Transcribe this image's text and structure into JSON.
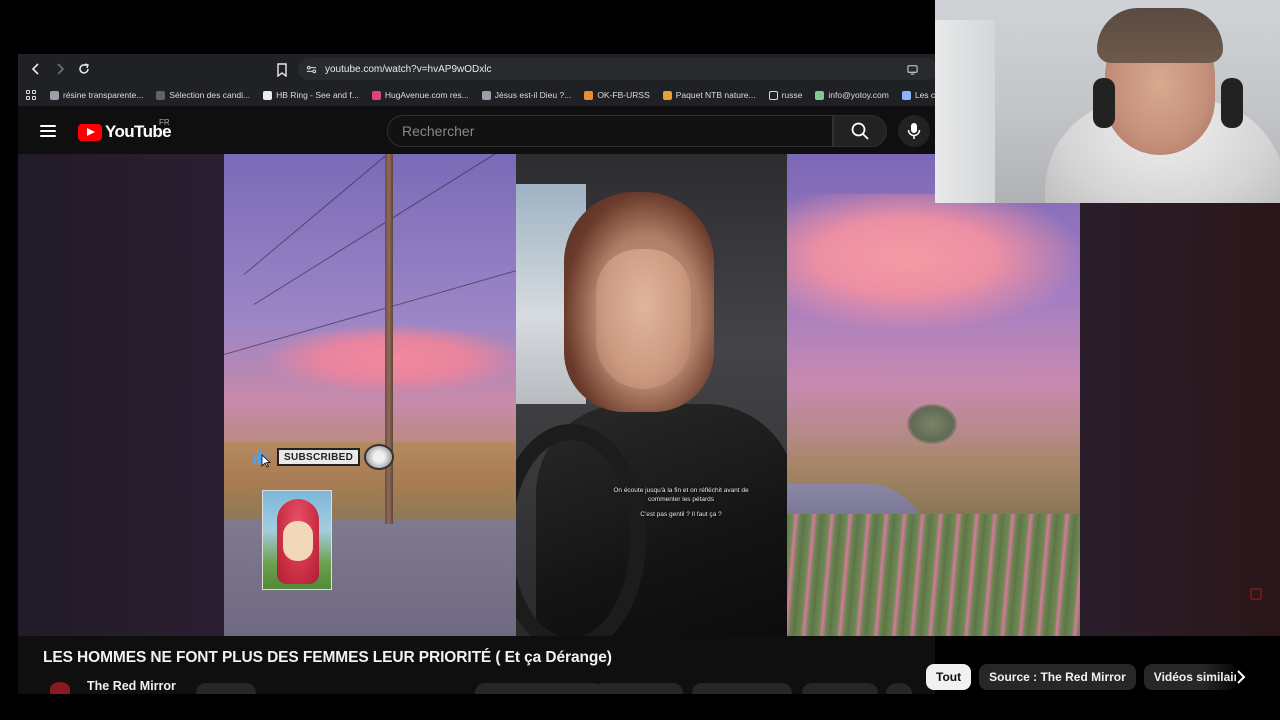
{
  "browser": {
    "url": "youtube.com/watch?v=hvAP9wODxlc",
    "bookmarks": [
      {
        "label": "résine transparente...",
        "color": "#9aa0a6"
      },
      {
        "label": "Sélection des candi...",
        "color": "#5f6368"
      },
      {
        "label": "HB Ring - See and f...",
        "color": "#e8eaed"
      },
      {
        "label": "HugAvenue.com res...",
        "color": "#e0427a"
      },
      {
        "label": "Jésus est-il Dieu ?...",
        "color": "#9aa0a6"
      },
      {
        "label": "OK-FB-URSS",
        "color": "#f28b30"
      },
      {
        "label": "Paquet NTB nature...",
        "color": "#e8a030"
      },
      {
        "label": "russe",
        "color": "#dadce0"
      },
      {
        "label": "info@yotoy.com",
        "color": "#81c995"
      },
      {
        "label": "Les concours",
        "color": "#8ab4f8"
      }
    ]
  },
  "youtube": {
    "logo_text": "YouTube",
    "region": "FR",
    "search_placeholder": "Rechercher",
    "brand_color": "#ff0000"
  },
  "video": {
    "caption_line1": "On écoute jusqu'à la fin et on réfléchit avant de commenter les pétards",
    "caption_line2": "C'est pas gentil ? Il faut ça ?",
    "subscribe_badge": "SUBSCRIBED",
    "title": "LES HOMMES NE FONT PLUS DES FEMMES LEUR PRIORITÉ ( Et ça Dérange)",
    "channel": "The Red Mirror"
  },
  "chips": [
    {
      "label": "Tout",
      "active": true
    },
    {
      "label": "Source : The Red Mirror",
      "active": false
    },
    {
      "label": "Vidéos similaires",
      "active": false
    }
  ]
}
